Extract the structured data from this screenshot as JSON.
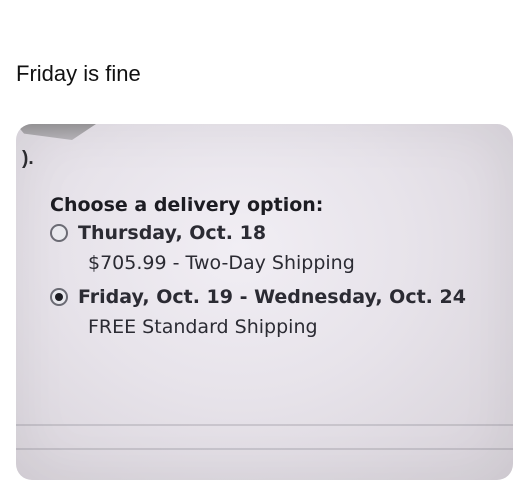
{
  "caption": "Friday is fine",
  "screenshot": {
    "side_glyph": ").",
    "heading": "Choose a delivery option:",
    "options": [
      {
        "selected": false,
        "date": "Thursday, Oct. 18",
        "detail": "$705.99 - Two-Day Shipping"
      },
      {
        "selected": true,
        "date": "Friday, Oct. 19 - Wednesday, Oct. 24",
        "detail": "FREE Standard Shipping"
      }
    ]
  },
  "colors": {
    "text": "#111111",
    "screen_background": "#e7e3ea"
  }
}
